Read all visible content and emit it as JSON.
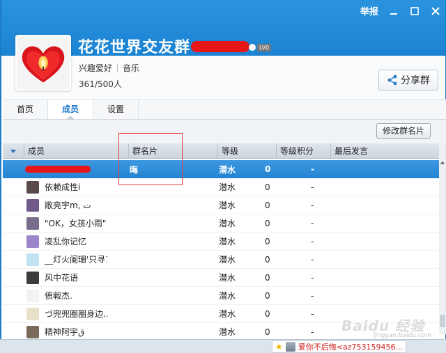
{
  "window": {
    "report_label": "举报"
  },
  "group": {
    "name": "花花世界交友群",
    "level_badge": "LV0",
    "category": "兴趣爱好",
    "subcategory": "音乐",
    "member_count": "361/500人"
  },
  "share_button": {
    "label": "分享群"
  },
  "tabs": [
    {
      "label": "首页",
      "active": false
    },
    {
      "label": "成员",
      "active": true
    },
    {
      "label": "设置",
      "active": false
    }
  ],
  "toolbar": {
    "edit_card_label": "修改群名片"
  },
  "table": {
    "columns": [
      "成员",
      "群名片",
      "等级",
      "等级积分",
      "最后发言"
    ],
    "rows": [
      {
        "member": "",
        "card": "晦",
        "level": "潜水",
        "points": "0",
        "last": "-",
        "selected": true,
        "redacted": true
      },
      {
        "member": "依赖成性i",
        "card": "",
        "level": "潜水",
        "points": "0",
        "last": "-",
        "avatar_color": "#5b4a4a"
      },
      {
        "member": "敞亮宇m, ت",
        "card": "",
        "level": "潜水",
        "points": "0",
        "last": "-",
        "avatar_color": "#6f5a8a"
      },
      {
        "member": "\"OK，女孩小雨\"",
        "card": "",
        "level": "潜水",
        "points": "0",
        "last": "-",
        "avatar_color": "#7a6d8c"
      },
      {
        "member": "凌乱你记忆",
        "card": "",
        "level": "潜水",
        "points": "0",
        "last": "-",
        "avatar_color": "#9b86c9"
      },
      {
        "member": "__灯火阑珊'只寻1...",
        "card": "",
        "level": "潜水",
        "points": "0",
        "last": "-",
        "avatar_color": "#bfe3f3"
      },
      {
        "member": "风中花语",
        "card": "",
        "level": "潜水",
        "points": "0",
        "last": "-",
        "avatar_color": "#3c3c3c"
      },
      {
        "member": "偾戦杰.",
        "card": "",
        "level": "潜水",
        "points": "0",
        "last": "-",
        "avatar_color": "#f2f2f2"
      },
      {
        "member": "づ兜兜圈圈身边...",
        "card": "",
        "level": "潜水",
        "points": "0",
        "last": "-",
        "avatar_color": "#e8e0c8"
      },
      {
        "member": "精神阿宇ق",
        "card": "",
        "level": "潜水",
        "points": "0",
        "last": "-",
        "avatar_color": "#7a6a5a"
      }
    ]
  },
  "notification": {
    "text": "爱你不后悔<az753159456..."
  },
  "watermark": {
    "brand": "Baidu 经验",
    "url": "jingyan.baidu.com"
  },
  "colors": {
    "header_blue": "#1e88d6",
    "selection_blue": "#2d8cd8",
    "redaction_red": "#e81717",
    "annotation_red": "#e23a3a",
    "link_active": "#1c79c9"
  },
  "icons": {
    "titlebar": [
      "minimize-icon",
      "maximize-icon",
      "close-icon"
    ],
    "share": "share-icon",
    "sort": "sort-down-icon"
  }
}
